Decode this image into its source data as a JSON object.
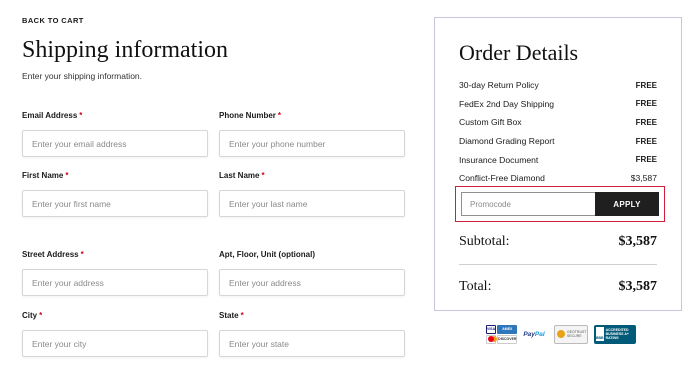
{
  "nav": {
    "back_label": "BACK TO CART"
  },
  "header": {
    "title": "Shipping information",
    "subtitle": "Enter your shipping information."
  },
  "form": {
    "email": {
      "label": "Email Address",
      "placeholder": "Enter your email address",
      "required": "*"
    },
    "phone": {
      "label": "Phone Number",
      "placeholder": "Enter your phone number",
      "required": "*"
    },
    "first_name": {
      "label": "First Name",
      "placeholder": "Enter your first name",
      "required": "*"
    },
    "last_name": {
      "label": "Last Name",
      "placeholder": "Enter your last name",
      "required": "*"
    },
    "street": {
      "label": "Street Address",
      "placeholder": "Enter your address",
      "required": "*"
    },
    "apt": {
      "label": "Apt, Floor, Unit (optional)",
      "placeholder": "Enter your address"
    },
    "city": {
      "label": "City",
      "placeholder": "Enter your city",
      "required": "*"
    },
    "state": {
      "label": "State",
      "placeholder": "Enter your state",
      "required": "*"
    }
  },
  "order": {
    "title": "Order Details",
    "lines": [
      {
        "label": "30-day Return Policy",
        "value": "FREE"
      },
      {
        "label": "FedEx 2nd Day Shipping",
        "value": "FREE"
      },
      {
        "label": "Custom Gift Box",
        "value": "FREE"
      },
      {
        "label": "Diamond Grading Report",
        "value": "FREE"
      },
      {
        "label": "Insurance Document",
        "value": "FREE"
      },
      {
        "label": "Conflict-Free Diamond",
        "value": "$3,587"
      }
    ],
    "promo": {
      "placeholder": "Promocode",
      "apply_label": "APPLY"
    },
    "subtotal": {
      "label": "Subtotal:",
      "value": "$3,587"
    },
    "total": {
      "label": "Total:",
      "value": "$3,587"
    }
  },
  "badges": {
    "cards": [
      "VISA",
      "AMEX",
      "MC",
      "DISCOVER"
    ],
    "paypal": {
      "part1": "Pay",
      "part2": "Pal"
    },
    "secure": "GeoTrust SECURE",
    "bbb": {
      "mark": "BBB",
      "text": "ACCREDITED BUSINESS A+ RATING"
    }
  }
}
